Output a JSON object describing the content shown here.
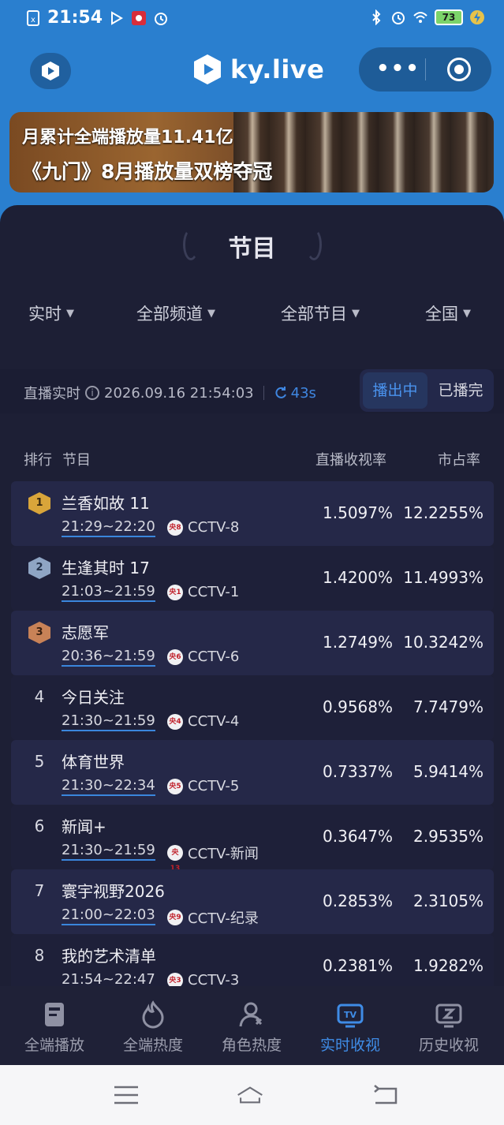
{
  "status": {
    "time": "21:54",
    "battery": "73"
  },
  "app": {
    "brand": "ky.live"
  },
  "banner": {
    "line1": "月累计全端播放量11.41亿",
    "line2": "《九门》8月播放量双榜夺冠"
  },
  "panel": {
    "title": "节目"
  },
  "filters": [
    "实时",
    "全部频道",
    "全部节目",
    "全国"
  ],
  "live": {
    "label": "直播实时",
    "timestamp": "2026.09.16 21:54:03",
    "refresh": "43s",
    "seg_on": "播出中",
    "seg_off": "已播完"
  },
  "table": {
    "headers": [
      "排行",
      "节目",
      "直播收视率",
      "市占率"
    ],
    "rows": [
      {
        "rank": "1",
        "medal": "gold",
        "name": "兰香如故 11",
        "time": "21:29~22:20",
        "logo": "央8",
        "channel": "CCTV-8",
        "rating": "1.5097%",
        "share": "12.2255%"
      },
      {
        "rank": "2",
        "medal": "silver",
        "name": "生逢其时 17",
        "time": "21:03~21:59",
        "logo": "央1",
        "channel": "CCTV-1",
        "rating": "1.4200%",
        "share": "11.4993%"
      },
      {
        "rank": "3",
        "medal": "bronze",
        "name": "志愿军",
        "time": "20:36~21:59",
        "logo": "央6",
        "channel": "CCTV-6",
        "rating": "1.2749%",
        "share": "10.3242%"
      },
      {
        "rank": "4",
        "medal": "",
        "name": "今日关注",
        "time": "21:30~21:59",
        "logo": "央4",
        "channel": "CCTV-4",
        "rating": "0.9568%",
        "share": "7.7479%"
      },
      {
        "rank": "5",
        "medal": "",
        "name": "体育世界",
        "time": "21:30~22:34",
        "logo": "央5",
        "channel": "CCTV-5",
        "rating": "0.7337%",
        "share": "5.9414%"
      },
      {
        "rank": "6",
        "medal": "",
        "name": "新闻+",
        "time": "21:30~21:59",
        "logo": "央13",
        "channel": "CCTV-新闻",
        "rating": "0.3647%",
        "share": "2.9535%"
      },
      {
        "rank": "7",
        "medal": "",
        "name": "寰宇视野2026",
        "time": "21:00~22:03",
        "logo": "央9",
        "channel": "CCTV-纪录",
        "rating": "0.2853%",
        "share": "2.3105%"
      },
      {
        "rank": "8",
        "medal": "",
        "name": "我的艺术清单",
        "time": "21:54~22:47",
        "logo": "央3",
        "channel": "CCTV-3",
        "rating": "0.2381%",
        "share": "1.9282%"
      }
    ]
  },
  "tabs": [
    {
      "label": "全端播放",
      "icon": "book-icon",
      "active": false
    },
    {
      "label": "全端热度",
      "icon": "flame-icon",
      "active": false
    },
    {
      "label": "角色热度",
      "icon": "person-icon",
      "active": false
    },
    {
      "label": "实时收视",
      "icon": "tv-icon",
      "active": true
    },
    {
      "label": "历史收视",
      "icon": "history-icon",
      "active": false
    }
  ]
}
